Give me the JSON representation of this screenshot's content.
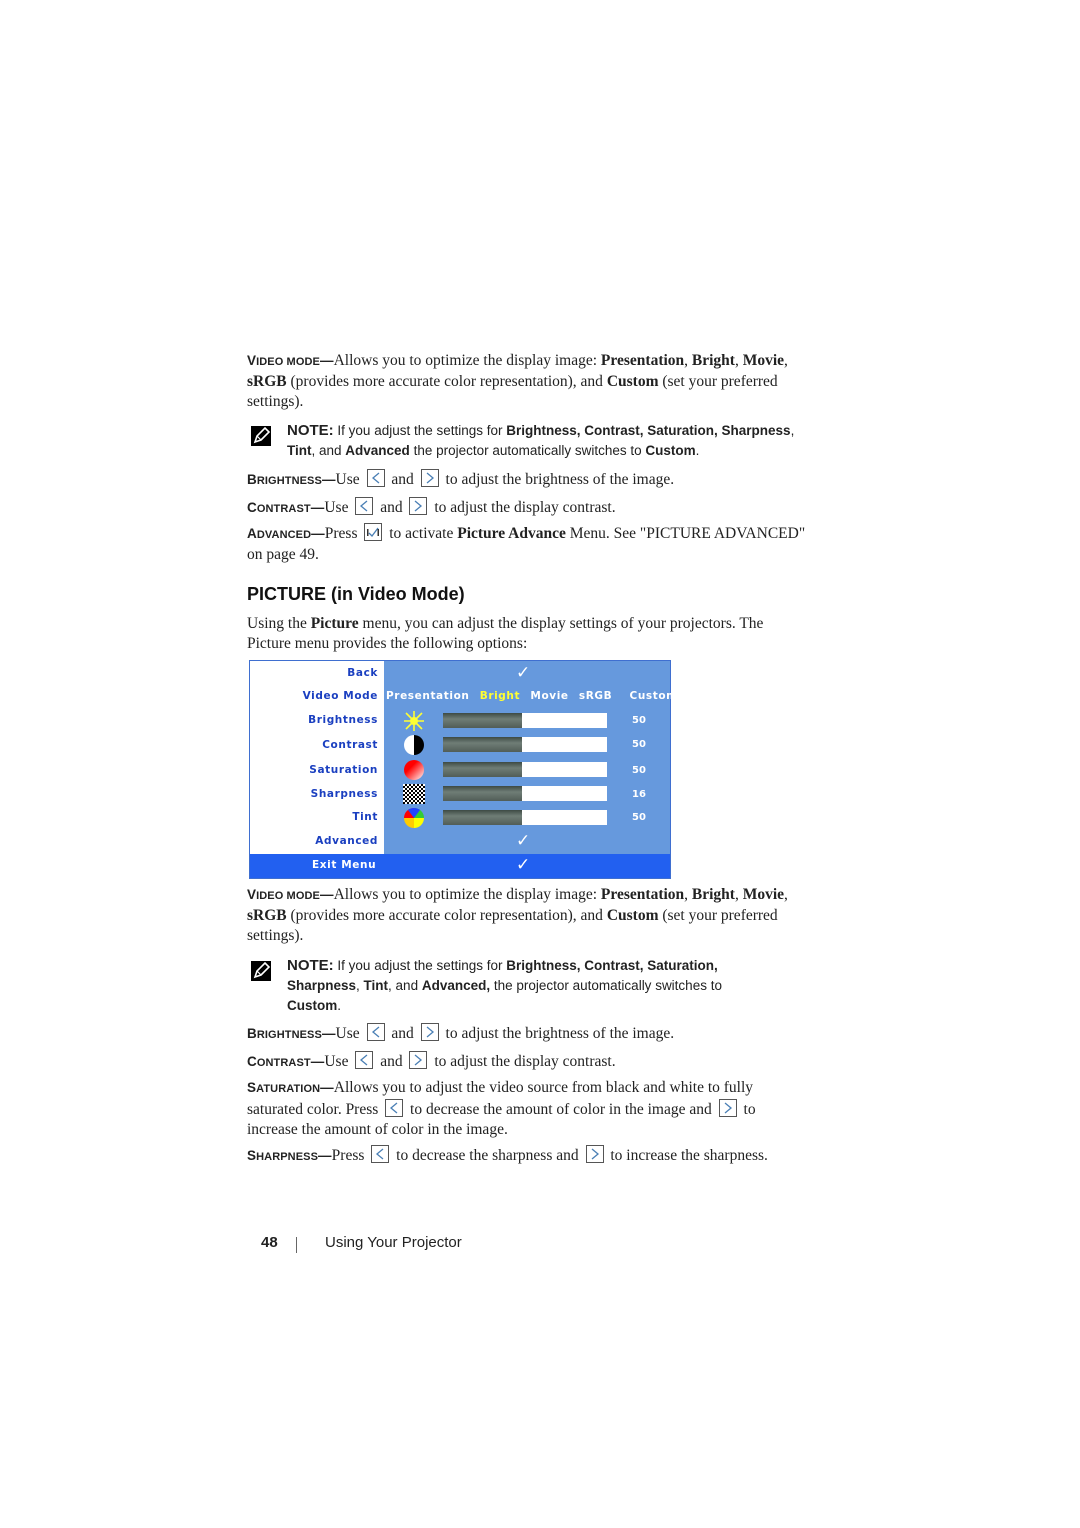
{
  "block1": {
    "video_mode": {
      "term_cap": "V",
      "term_rest": "IDEO MODE",
      "dash": "—",
      "text_a": "Allows you to optimize the display image: ",
      "b1": "Presentation",
      "c1": ", ",
      "b2": "Bright",
      "c2": ", ",
      "b3": "Movie",
      "c3": ", ",
      "b4": "sRGB",
      "text_b": " (provides more accurate color representation), and ",
      "b5": "Custom",
      "text_c": " (set your preferred settings)."
    },
    "note": {
      "label": "NOTE:",
      "text_a": " If you adjust the settings for ",
      "b1": "Brightness, Contrast, Saturation, Sharpness",
      "c1": ", ",
      "b2": "Tint",
      "c2": ", and ",
      "b3": "Advanced",
      "text_b": " the projector automatically switches to ",
      "b4": "Custom",
      "end": "."
    },
    "brightness": {
      "term_cap": "B",
      "term_rest": "RIGHTNESS",
      "dash": "—",
      "use": "Use",
      "and": "and",
      "text": "to adjust the brightness of the image."
    },
    "contrast": {
      "term_cap": "C",
      "term_rest": "ONTRAST",
      "dash": "—",
      "use": "Use",
      "and": "and",
      "text": "to adjust the display contrast."
    },
    "advanced": {
      "term_cap": "A",
      "term_rest": "DVANCED",
      "dash": "—",
      "press": "Press",
      "text_a": " to activate ",
      "b1": "Picture Advance",
      "text_b": " Menu. See \"PICTURE ADVANCED\" on page 49."
    }
  },
  "section": {
    "title": "PICTURE (in Video Mode)",
    "intro_a": "Using the ",
    "intro_b1": "Picture",
    "intro_b": " menu, you can adjust the display settings of your projectors. The Picture menu provides the following options:"
  },
  "osd_menu": {
    "colors": {
      "panel": "#6699dd",
      "label": "#1a3fc0",
      "exit_bar": "#2260f0",
      "selected_mode": "#ffff33"
    },
    "rows": [
      {
        "label": "Back",
        "type": "check"
      },
      {
        "label": "Video Mode",
        "type": "modes"
      },
      {
        "label": "Brightness",
        "type": "slider",
        "icon": "sun-icon",
        "value": "50",
        "fill_percent": 48
      },
      {
        "label": "Contrast",
        "type": "slider",
        "icon": "contrast-icon",
        "value": "50",
        "fill_percent": 48
      },
      {
        "label": "Saturation",
        "type": "slider",
        "icon": "saturation-icon",
        "value": "50",
        "fill_percent": 48
      },
      {
        "label": "Sharpness",
        "type": "slider",
        "icon": "sharpness-icon",
        "value": "16",
        "fill_percent": 48
      },
      {
        "label": "Tint",
        "type": "slider",
        "icon": "tint-icon",
        "value": "50",
        "fill_percent": 48
      },
      {
        "label": "Advanced",
        "type": "check"
      }
    ],
    "modes": [
      "Presentation",
      "Bright",
      "Movie",
      "sRGB",
      "Custom"
    ],
    "selected_mode": "Bright",
    "exit_label": "Exit Menu",
    "check_glyph": "✓"
  },
  "block2": {
    "video_mode": {
      "term_cap": "V",
      "term_rest": "IDEO MODE",
      "dash": "—",
      "text_a": "Allows you to optimize the display image: ",
      "b1": "Presentation",
      "c1": ", ",
      "b2": "Bright",
      "c2": ", ",
      "b3": "Movie",
      "c3": ", ",
      "b4": "sRGB",
      "text_b": " (provides more accurate color representation), and ",
      "b5": "Custom",
      "text_c": " (set your preferred settings)."
    },
    "note": {
      "label": "NOTE:",
      "text_a": " If you adjust the settings for ",
      "b1": "Brightness, Contrast, Saturation, Sharpness",
      "c1": ", ",
      "b2": "Tint",
      "c2": ", and ",
      "b3": "Advanced,",
      "text_b": " the projector automatically switches to ",
      "b4": "Custom",
      "end": "."
    },
    "brightness": {
      "term_cap": "B",
      "term_rest": "RIGHTNESS",
      "dash": "—",
      "use": "Use",
      "and": "and",
      "text": "to adjust the brightness of the image."
    },
    "contrast": {
      "term_cap": "C",
      "term_rest": "ONTRAST",
      "dash": "—",
      "use": "Use",
      "and": "and",
      "text": "to adjust the display contrast."
    },
    "saturation": {
      "term_cap": "S",
      "term_rest": "ATURATION",
      "dash": "—",
      "text_a": "Allows you to adjust the video source from black and white to fully saturated color. Press",
      "text_b": "to decrease the amount of color in the image and",
      "text_c": "to increase the amount of color in the image."
    },
    "sharpness": {
      "term_cap": "S",
      "term_rest": "HARPNESS",
      "dash": "—",
      "press": "Press",
      "text_a": "to decrease the sharpness and",
      "text_b": "to increase the sharpness."
    }
  },
  "footer": {
    "page_number": "48",
    "chapter": "Using Your Projector"
  }
}
